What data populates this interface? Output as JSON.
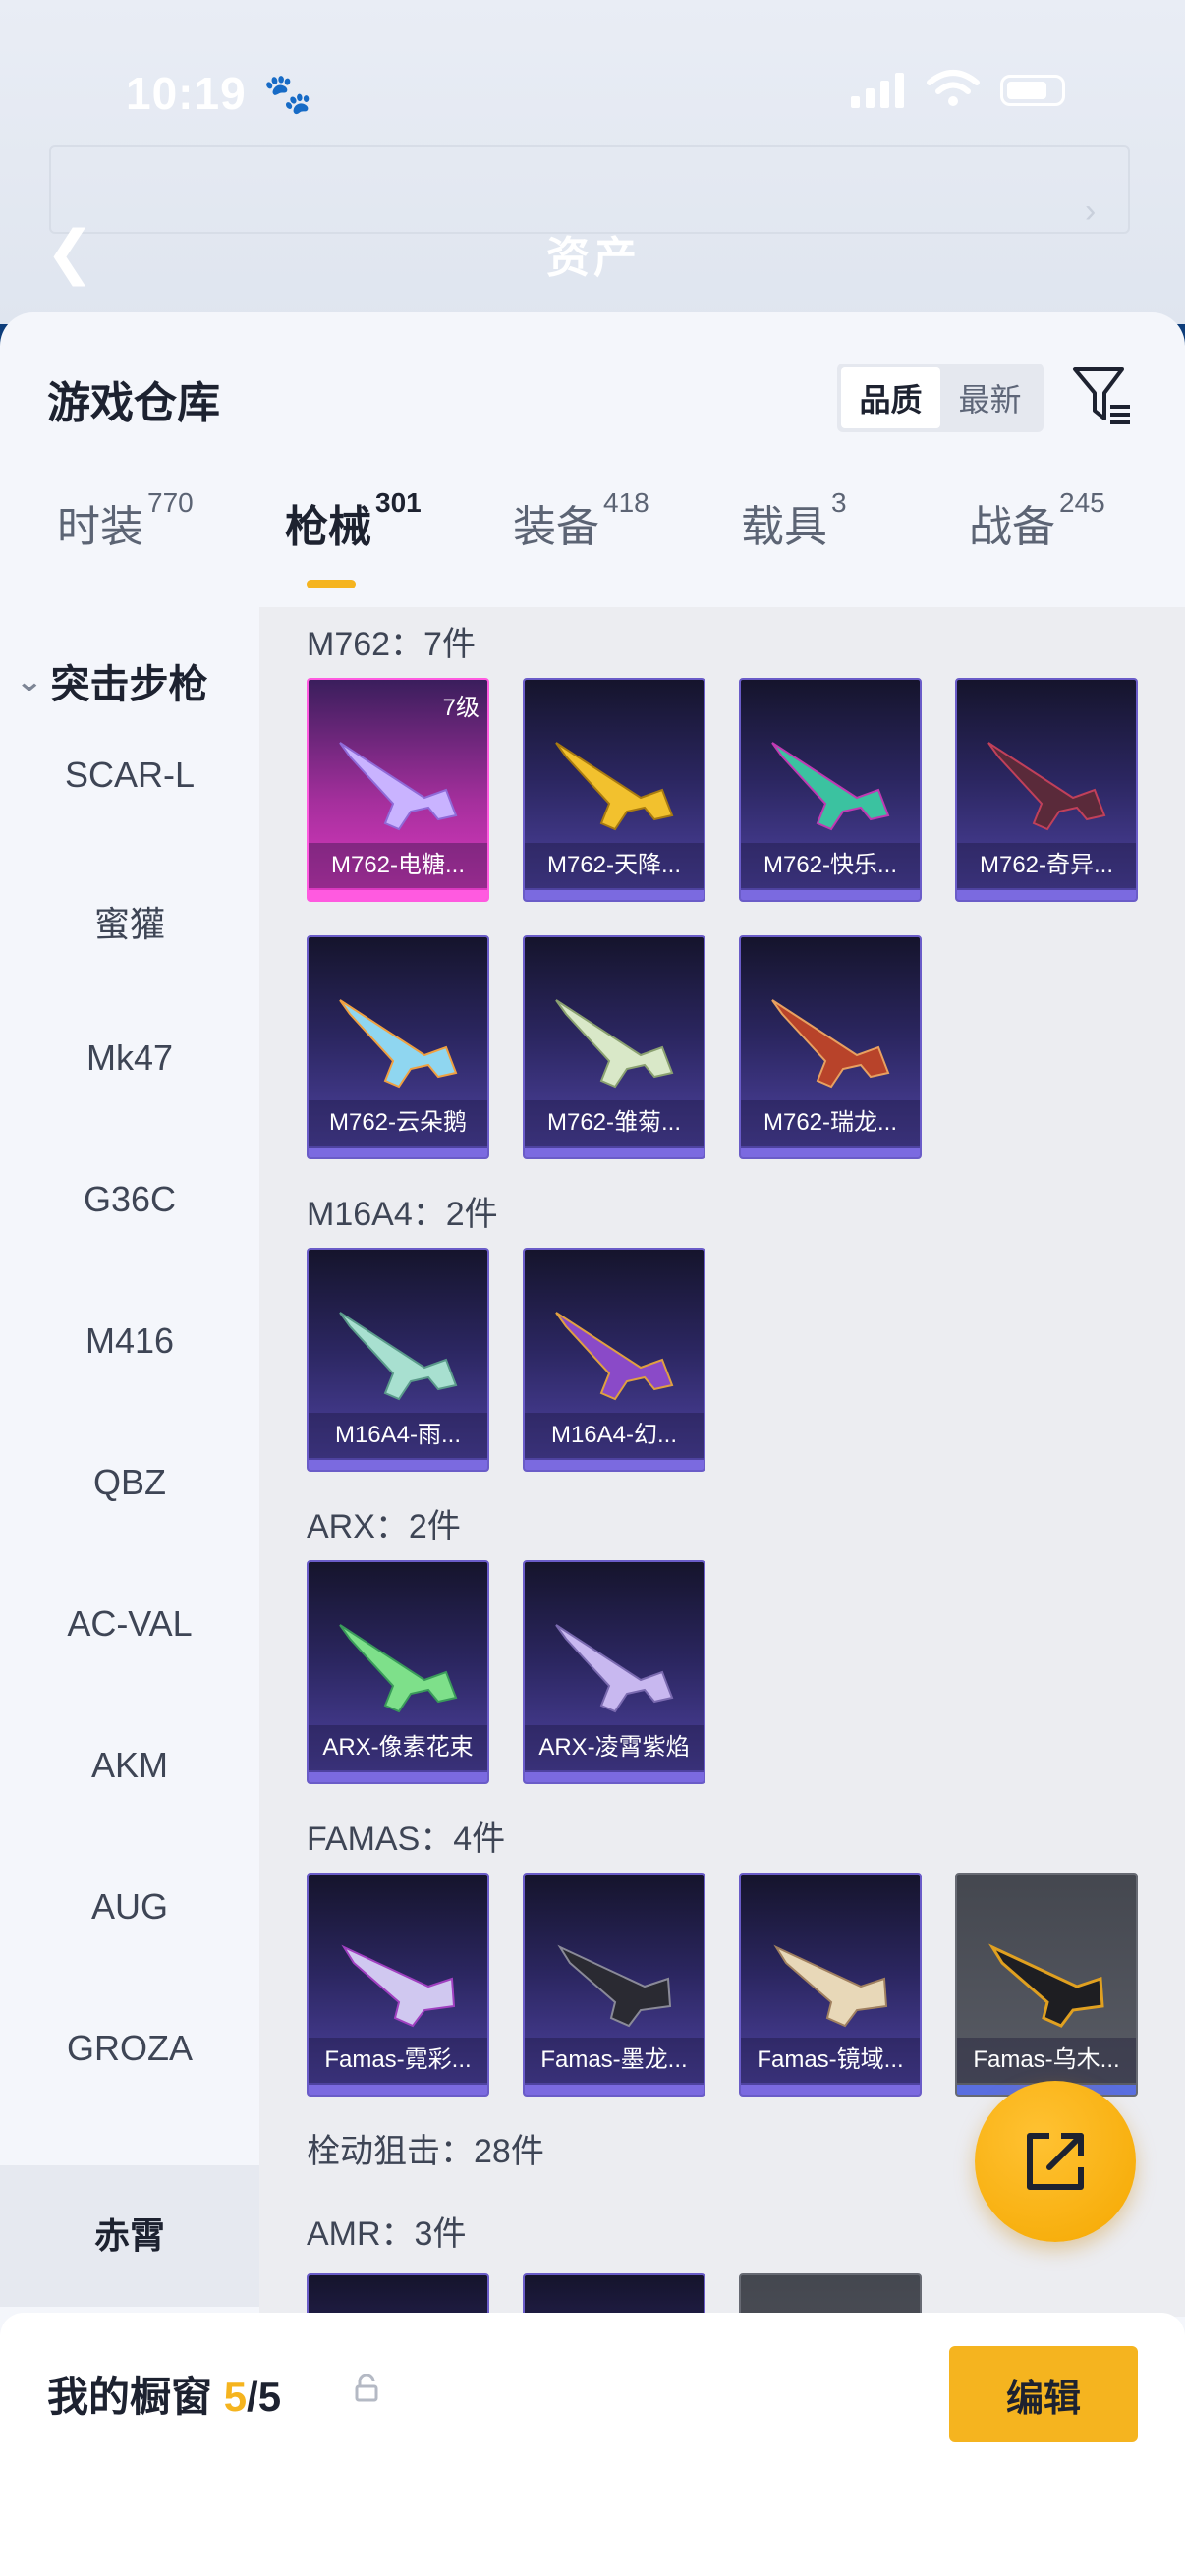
{
  "status": {
    "time": "10:19"
  },
  "header": {
    "title": "资产"
  },
  "sheet": {
    "title": "游戏仓库",
    "sort": {
      "options": [
        "品质",
        "最新"
      ],
      "selected": "品质"
    }
  },
  "tabs": [
    {
      "label": "时装",
      "count": "770"
    },
    {
      "label": "枪械",
      "count": "301"
    },
    {
      "label": "装备",
      "count": "418"
    },
    {
      "label": "载具",
      "count": "3"
    },
    {
      "label": "战备",
      "count": "245"
    }
  ],
  "sidebar": {
    "category": "突击步枪",
    "items": [
      "SCAR-L",
      "蜜獾",
      "Mk47",
      "G36C",
      "M416",
      "QBZ",
      "AC-VAL",
      "AKM",
      "AUG",
      "GROZA",
      "赤霄"
    ],
    "selected": "赤霄"
  },
  "groups": [
    {
      "label": "M762：7件",
      "items": [
        {
          "name": "M762-电糖...",
          "level": "7级",
          "style": "pink"
        },
        {
          "name": "M762-天降...",
          "style": "purple"
        },
        {
          "name": "M762-快乐...",
          "style": "purple"
        },
        {
          "name": "M762-奇异...",
          "style": "purple"
        },
        {
          "name": "M762-云朵鹅",
          "style": "purple"
        },
        {
          "name": "M762-雏菊...",
          "style": "purple"
        },
        {
          "name": "M762-瑞龙...",
          "style": "purple"
        }
      ]
    },
    {
      "label": "M16A4：2件",
      "items": [
        {
          "name": "M16A4-雨...",
          "style": "purple"
        },
        {
          "name": "M16A4-幻...",
          "style": "purple"
        }
      ]
    },
    {
      "label": "ARX：2件",
      "items": [
        {
          "name": "ARX-像素花束",
          "style": "purple"
        },
        {
          "name": "ARX-凌霄紫焰",
          "style": "purple"
        }
      ]
    },
    {
      "label": "FAMAS：4件",
      "items": [
        {
          "name": "Famas-霓彩...",
          "style": "purple"
        },
        {
          "name": "Famas-墨龙...",
          "style": "purple"
        },
        {
          "name": "Famas-镜域...",
          "style": "purple"
        },
        {
          "name": "Famas-乌木...",
          "style": "gray"
        }
      ]
    }
  ],
  "subsection": "栓动狙击：28件",
  "amr_label": "AMR：3件",
  "showcase": {
    "label": "我的橱窗",
    "current": "5",
    "total": "/5",
    "edit_label": "编辑"
  },
  "colors": {
    "accent": "#f5b41f",
    "card_purple": "#5145a6",
    "card_pink": "#e23ac4"
  }
}
